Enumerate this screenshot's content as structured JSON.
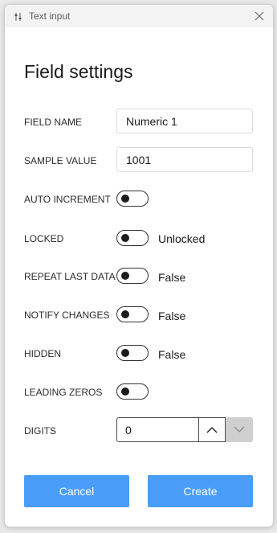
{
  "window": {
    "title": "Text input",
    "icon": "sliders-icon",
    "close_icon": "close-icon"
  },
  "heading": "Field settings",
  "fields": {
    "field_name": {
      "label": "FIELD NAME",
      "value": "Numeric 1"
    },
    "sample_value": {
      "label": "SAMPLE VALUE",
      "value": "1001"
    },
    "auto_increment": {
      "label": "AUTO INCREMENT",
      "on": false,
      "state_text": ""
    },
    "locked": {
      "label": "LOCKED",
      "on": false,
      "state_text": "Unlocked"
    },
    "repeat_last_data": {
      "label": "REPEAT LAST DATA",
      "on": false,
      "state_text": "False"
    },
    "notify_changes": {
      "label": "NOTIFY CHANGES",
      "on": false,
      "state_text": "False"
    },
    "hidden": {
      "label": "HIDDEN",
      "on": false,
      "state_text": "False"
    },
    "leading_zeros": {
      "label": "LEADING ZEROS",
      "on": false,
      "state_text": ""
    },
    "digits": {
      "label": "DIGITS",
      "value": "0",
      "up_icon": "chevron-up-icon",
      "down_icon": "chevron-down-icon",
      "down_enabled": false
    }
  },
  "buttons": {
    "cancel": "Cancel",
    "create": "Create"
  },
  "colors": {
    "primary_button": "#4a9df8",
    "disabled_spinner": "#cfcfcf",
    "titlebar": "#f3f3f3"
  }
}
